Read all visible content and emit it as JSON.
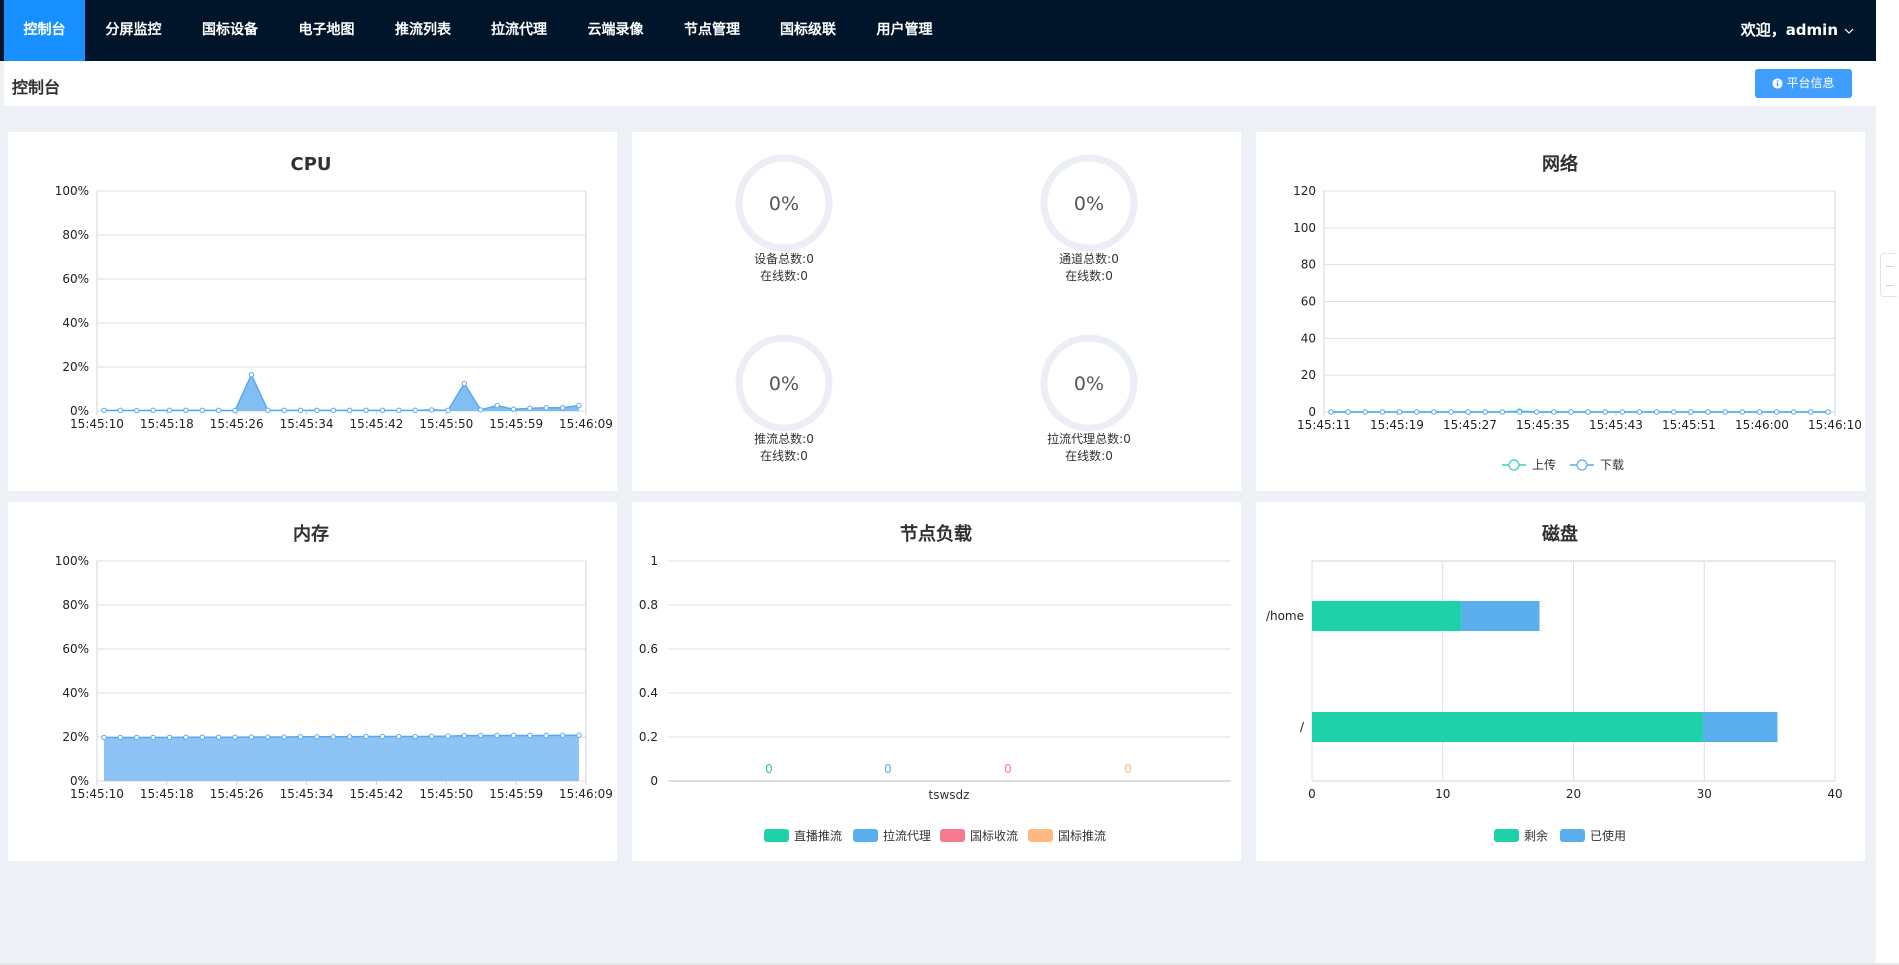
{
  "nav": {
    "items": [
      {
        "label": "控制台",
        "name": "nav-item-console",
        "active": true
      },
      {
        "label": "分屏监控",
        "name": "nav-item-split-monitor",
        "active": false
      },
      {
        "label": "国标设备",
        "name": "nav-item-gb-devices",
        "active": false
      },
      {
        "label": "电子地图",
        "name": "nav-item-map",
        "active": false
      },
      {
        "label": "推流列表",
        "name": "nav-item-push-list",
        "active": false
      },
      {
        "label": "拉流代理",
        "name": "nav-item-pull-proxy",
        "active": false
      },
      {
        "label": "云端录像",
        "name": "nav-item-cloud-record",
        "active": false
      },
      {
        "label": "节点管理",
        "name": "nav-item-node-manage",
        "active": false
      },
      {
        "label": "国标级联",
        "name": "nav-item-gb-cascade",
        "active": false
      },
      {
        "label": "用户管理",
        "name": "nav-item-user-manage",
        "active": false
      }
    ],
    "user": "欢迎，admin"
  },
  "breadcrumb": {
    "title": "控制台",
    "button_label": "平台信息",
    "button_icon": "info-circle-icon"
  },
  "colors": {
    "nav_bg": "#001529",
    "active": "#1890ff",
    "button": "#409eff",
    "line": "#5aa8ef",
    "teal": "#1fd1a8",
    "blue": "#5aaeee",
    "pink": "#f57a8e",
    "orange": "#ffba84",
    "donut": "#ebeef5"
  },
  "chart_data": [
    {
      "type": "area",
      "title": "CPU",
      "x_ticks": [
        "15:45:10",
        "15:45:18",
        "15:45:26",
        "15:45:34",
        "15:45:42",
        "15:45:50",
        "15:45:59",
        "15:46:09"
      ],
      "y_ticks": [
        "0%",
        "20%",
        "40%",
        "60%",
        "80%",
        "100%"
      ],
      "ylim": [
        0,
        100
      ],
      "series": [
        {
          "values": [
            0.3,
            0.3,
            0.2,
            0.3,
            0.3,
            0.3,
            0.3,
            0.3,
            0.2,
            16.5,
            0.3,
            0.3,
            0.3,
            0.3,
            0.3,
            0.3,
            0.3,
            0.3,
            0.3,
            0.3,
            0.5,
            0.3,
            12.5,
            0.5,
            2.5,
            0.8,
            1.2,
            1.5,
            1.5,
            2.5
          ]
        }
      ]
    },
    {
      "type": "donut-stats",
      "items": [
        {
          "percent": "0%",
          "line1": "设备总数:0",
          "line2": "在线数:0"
        },
        {
          "percent": "0%",
          "line1": "通道总数:0",
          "line2": "在线数:0"
        },
        {
          "percent": "0%",
          "line1": "推流总数:0",
          "line2": "在线数:0"
        },
        {
          "percent": "0%",
          "line1": "拉流代理总数:0",
          "line2": "在线数:0"
        }
      ]
    },
    {
      "type": "line",
      "title": "网络",
      "x_ticks": [
        "15:45:11",
        "15:45:19",
        "15:45:27",
        "15:45:35",
        "15:45:43",
        "15:45:51",
        "15:46:00",
        "15:46:10"
      ],
      "y_ticks": [
        "0",
        "20",
        "40",
        "60",
        "80",
        "100",
        "120"
      ],
      "ylim": [
        0,
        120
      ],
      "series": [
        {
          "name": "上传",
          "values": [
            0,
            0,
            0,
            0,
            0,
            0,
            0,
            0,
            0,
            0,
            0,
            0.5,
            0,
            0,
            0,
            0,
            0,
            0,
            0,
            0,
            0,
            0,
            0,
            0,
            0,
            0,
            0,
            0,
            0,
            0
          ]
        },
        {
          "name": "下载",
          "values": [
            0,
            0,
            0,
            0,
            0,
            0,
            0,
            0,
            0,
            0,
            0,
            0,
            0,
            0,
            0,
            0,
            0,
            0,
            0,
            0,
            0,
            0,
            0,
            0,
            0,
            0,
            0,
            0,
            0,
            0
          ]
        }
      ],
      "legend": "bottom"
    },
    {
      "type": "area",
      "title": "内存",
      "x_ticks": [
        "15:45:10",
        "15:45:18",
        "15:45:26",
        "15:45:34",
        "15:45:42",
        "15:45:50",
        "15:45:59",
        "15:46:09"
      ],
      "y_ticks": [
        "0%",
        "20%",
        "40%",
        "60%",
        "80%",
        "100%"
      ],
      "ylim": [
        0,
        100
      ],
      "series": [
        {
          "values": [
            19.8,
            19.8,
            19.8,
            19.8,
            19.8,
            19.9,
            19.9,
            19.9,
            19.9,
            20,
            20,
            20,
            20.1,
            20.1,
            20.1,
            20.1,
            20.2,
            20.2,
            20.2,
            20.2,
            20.3,
            20.4,
            20.6,
            20.7,
            20.7,
            20.7,
            20.7,
            20.7,
            20.8,
            20.8
          ]
        }
      ]
    },
    {
      "type": "bar",
      "title": "节点负载",
      "categories": [
        "tswsdz"
      ],
      "y_ticks": [
        "0",
        "0.2",
        "0.4",
        "0.6",
        "0.8",
        "1"
      ],
      "ylim": [
        0,
        1
      ],
      "series": [
        {
          "name": "直播推流",
          "values": [
            0
          ]
        },
        {
          "name": "拉流代理",
          "values": [
            0
          ]
        },
        {
          "name": "国标收流",
          "values": [
            0
          ]
        },
        {
          "name": "国标推流",
          "values": [
            0
          ]
        }
      ],
      "legend": "bottom"
    },
    {
      "type": "bar",
      "orientation": "horizontal",
      "stacked": true,
      "title": "磁盘",
      "categories": [
        "/home",
        "/"
      ],
      "x_ticks": [
        "0",
        "10",
        "20",
        "30",
        "40"
      ],
      "xlim": [
        0,
        40
      ],
      "series": [
        {
          "name": "剩余",
          "values": [
            11.4,
            29.9
          ]
        },
        {
          "name": "已使用",
          "values": [
            6,
            5.7
          ]
        }
      ],
      "legend": "bottom"
    }
  ]
}
